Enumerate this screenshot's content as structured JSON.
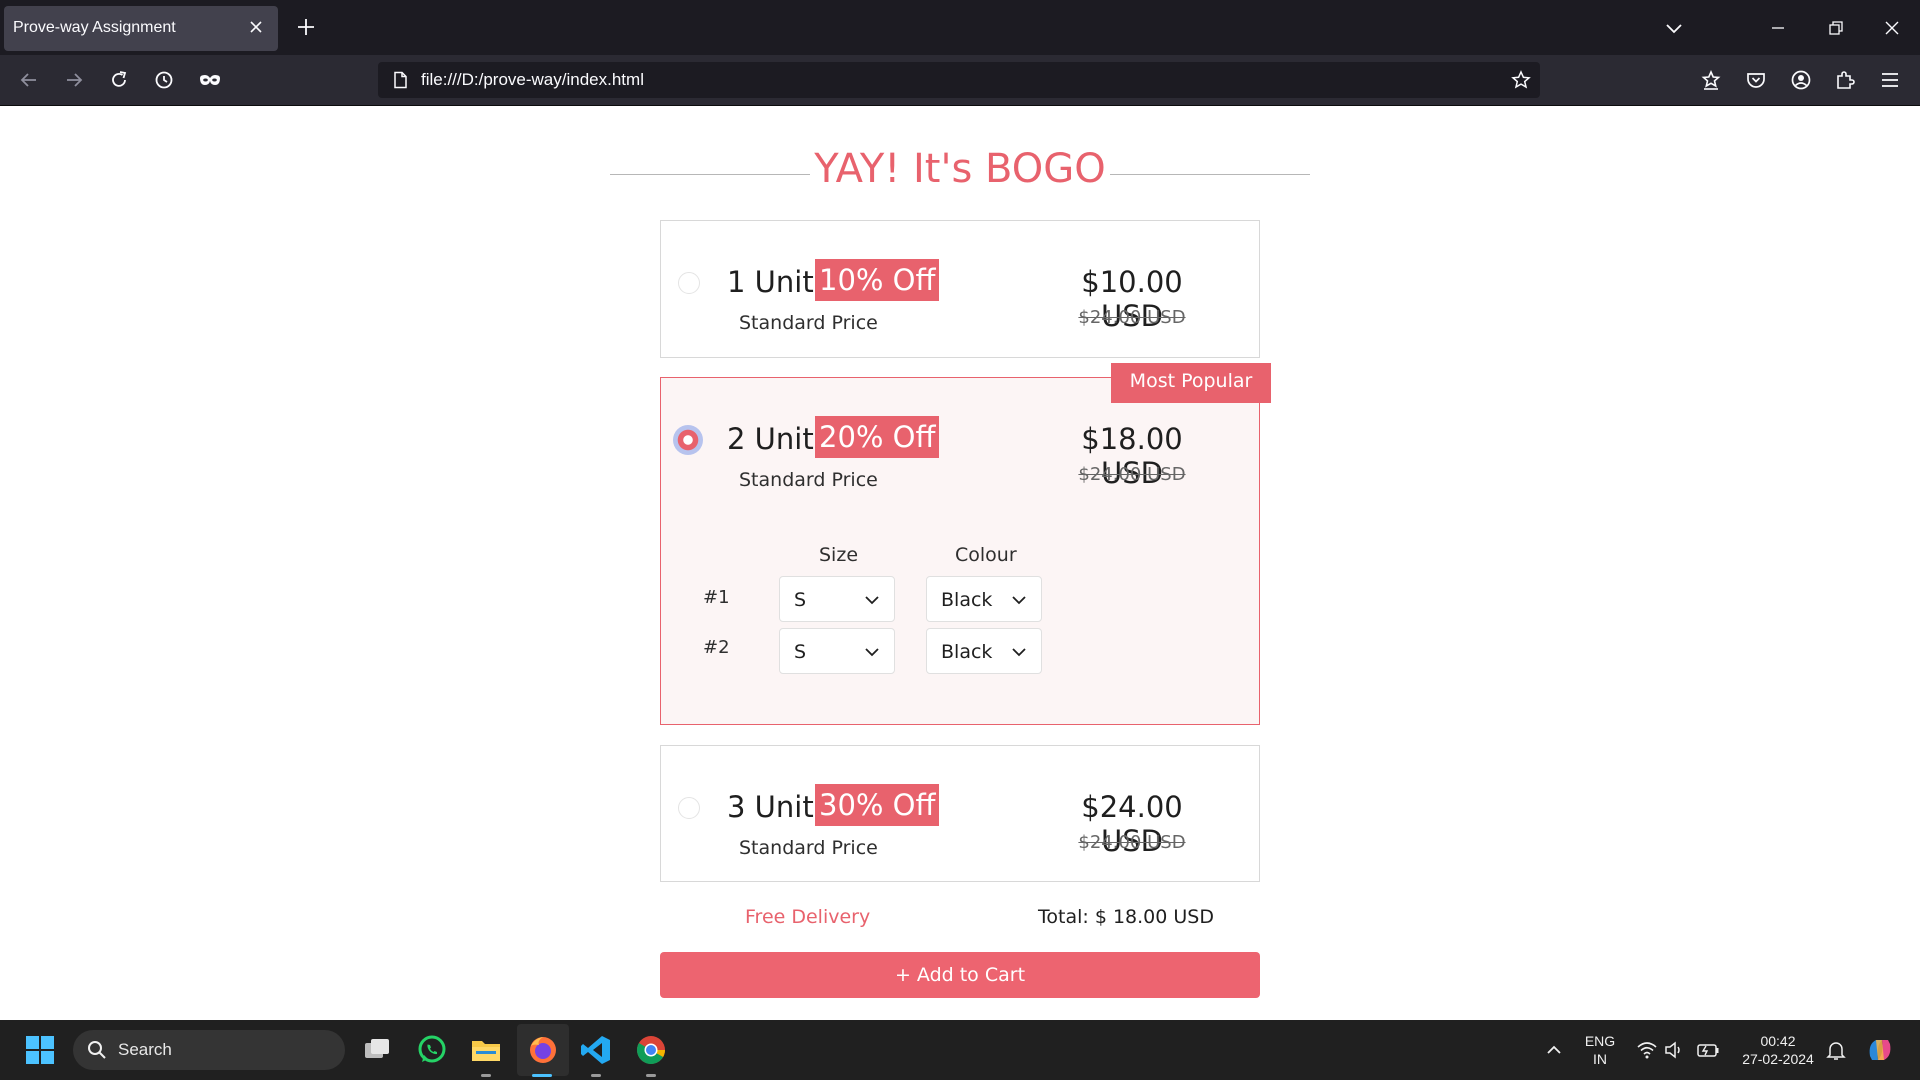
{
  "browser": {
    "tab_title": "Prove-way Assignment",
    "url": "file:///D:/prove-way/index.html"
  },
  "page": {
    "heading": "YAY! It's BOGO",
    "options": [
      {
        "units": "1 Unit",
        "discount": "10% Off",
        "subtitle": "Standard Price",
        "price": "$10.00 USD",
        "original_price": "$24.00 USD",
        "selected": false
      },
      {
        "units": "2 Unit",
        "discount": "20% Off",
        "subtitle": "Standard Price",
        "price": "$18.00 USD",
        "original_price": "$24.00 USD",
        "selected": true,
        "badge": "Most Popular",
        "size_header": "Size",
        "colour_header": "Colour",
        "rows": [
          {
            "label": "#1",
            "size": "S",
            "colour": "Black"
          },
          {
            "label": "#2",
            "size": "S",
            "colour": "Black"
          }
        ]
      },
      {
        "units": "3 Unit",
        "discount": "30% Off",
        "subtitle": "Standard Price",
        "price": "$24.00 USD",
        "original_price": "$24.00 USD",
        "selected": false
      }
    ],
    "free_delivery": "Free Delivery",
    "total": "Total: $ 18.00 USD",
    "add_to_cart": "+ Add to Cart"
  },
  "taskbar": {
    "search_placeholder": "Search",
    "lang_top": "ENG",
    "lang_bottom": "IN",
    "time": "00:42",
    "date": "27-02-2024"
  },
  "colors": {
    "accent": "#e8626d",
    "chrome_dark": "#1c1b22",
    "taskbar": "#202020"
  }
}
